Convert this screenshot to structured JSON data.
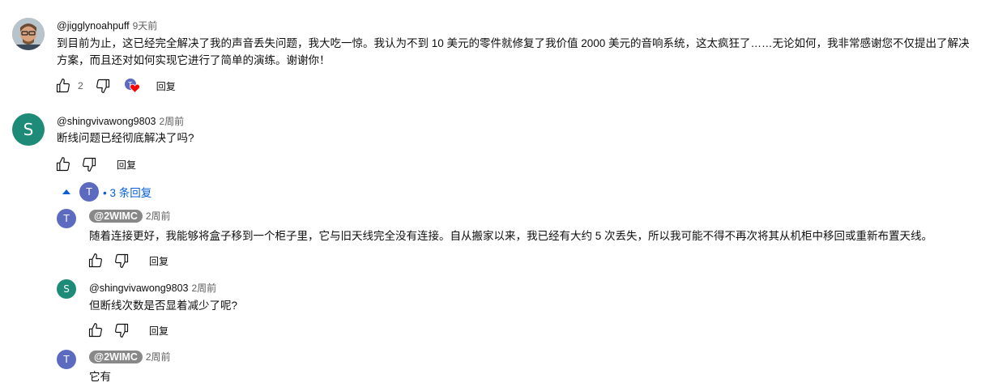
{
  "comments": [
    {
      "author": "@jigglynoahpuff",
      "time": "9天前",
      "text": "到目前为止，这已经完全解决了我的声音丢失问题，我大吃一惊。我认为不到 10 美元的零件就修复了我价值 2000 美元的音响系统，这太疯狂了……无论如何，我非常感谢您不仅提出了解决方案，而且还对如何实现它进行了简单的演练。谢谢你！",
      "likes": "2",
      "hearted_avatar_letter": "T",
      "reply_label": "回复"
    },
    {
      "author": "@shingvivawong9803",
      "time": "2周前",
      "avatar_letter": "S",
      "text": "断线问题已经彻底解决了吗?",
      "reply_label": "回复",
      "replies_toggle": {
        "avatar_letter": "T",
        "label": "• 3 条回复"
      }
    }
  ],
  "replies": [
    {
      "author": "@2WIMC",
      "time": "2周前",
      "avatar_letter": "T",
      "text": "随着连接更好，我能够将盒子移到一个柜子里，它与旧天线完全没有连接。自从搬家以来，我已经有大约 5 次丢失，所以我可能不得不再次将其从机柜中移回或重新布置天线。",
      "reply_label": "回复"
    },
    {
      "author": "@shingvivawong9803",
      "time": "2周前",
      "avatar_letter": "S",
      "text": "但断线次数是否显着减少了呢?",
      "reply_label": "回复"
    },
    {
      "author": "@2WIMC",
      "time": "2周前",
      "avatar_letter": "T",
      "text": "它有"
    }
  ],
  "colors": {
    "teal_avatar": "#1e8a78",
    "indigo_avatar": "#5c6bc0",
    "link_blue": "#065fd4",
    "heart_red": "#ff0000"
  }
}
